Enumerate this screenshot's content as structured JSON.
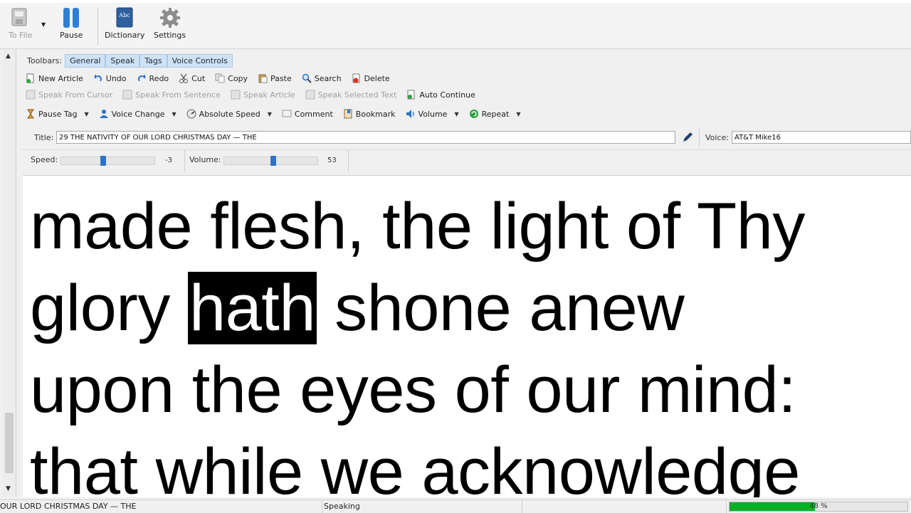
{
  "ribbon": {
    "to_file": "To File",
    "pause": "Pause",
    "dictionary": "Dictionary",
    "dictionary_icon_text": "Abc",
    "settings": "Settings"
  },
  "toolbars": {
    "label": "Toolbars:",
    "tabs": [
      "General",
      "Speak",
      "Tags",
      "Voice Controls"
    ]
  },
  "edit_row": [
    "New Article",
    "Undo",
    "Redo",
    "Cut",
    "Copy",
    "Paste",
    "Search",
    "Delete"
  ],
  "speak_row": [
    "Speak From Cursor",
    "Speak From Sentence",
    "Speak Article",
    "Speak Selected Text",
    "Auto Continue"
  ],
  "tags_row": [
    "Pause Tag",
    "Voice Change",
    "Absolute Speed",
    "Comment",
    "Bookmark",
    "Volume",
    "Repeat"
  ],
  "title_label": "Title:",
  "title_value": "29 THE NATIVITY OF OUR LORD CHRISTMAS DAY — THE",
  "voice_label": "Voice:",
  "voice_value": "AT&T Mike16",
  "speed_label": "Speed:",
  "speed_value": "-3",
  "speed_level": 0.45,
  "volume_label": "Volume:",
  "volume_value": "53",
  "volume_level": 0.53,
  "text": {
    "line1": "made flesh, the light of Thy",
    "line2_before": "glory ",
    "line2_highlight": "hath",
    "line2_after": " shone anew",
    "line3": "upon the eyes of our mind:",
    "line4": "that while we acknowledge"
  },
  "status": {
    "title": "OUR LORD CHRISTMAS DAY — THE",
    "state": "Speaking",
    "progress_text": "48 %",
    "progress": 0.48
  },
  "colors": {
    "accent": "#2f73c9",
    "progress": "#06b025",
    "tab": "#cfe2f5"
  }
}
